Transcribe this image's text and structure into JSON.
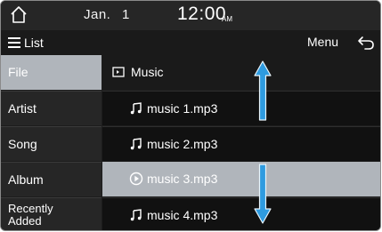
{
  "status": {
    "date": "Jan.",
    "day": "1",
    "time": "12:00",
    "ampm": "AM"
  },
  "titlebar": {
    "list_label": "List",
    "menu_label": "Menu"
  },
  "categories": [
    {
      "label": "File",
      "active": true
    },
    {
      "label": "Artist",
      "active": false
    },
    {
      "label": "Song",
      "active": false
    },
    {
      "label": "Album",
      "active": false
    },
    {
      "label": "Recently Added",
      "active": false
    }
  ],
  "files": [
    {
      "label": "Music",
      "icon": "folder-icon"
    },
    {
      "label": "music 1.mp3",
      "icon": "music-note-icon"
    },
    {
      "label": "music 2.mp3",
      "icon": "music-note-icon"
    },
    {
      "label": "music 3.mp3",
      "icon": "play-circle-icon",
      "selected": true
    },
    {
      "label": "music 4.mp3",
      "icon": "music-note-icon"
    }
  ],
  "colors": {
    "selected_row": "#b0b5bb",
    "arrow_fill": "#2e9be0"
  }
}
